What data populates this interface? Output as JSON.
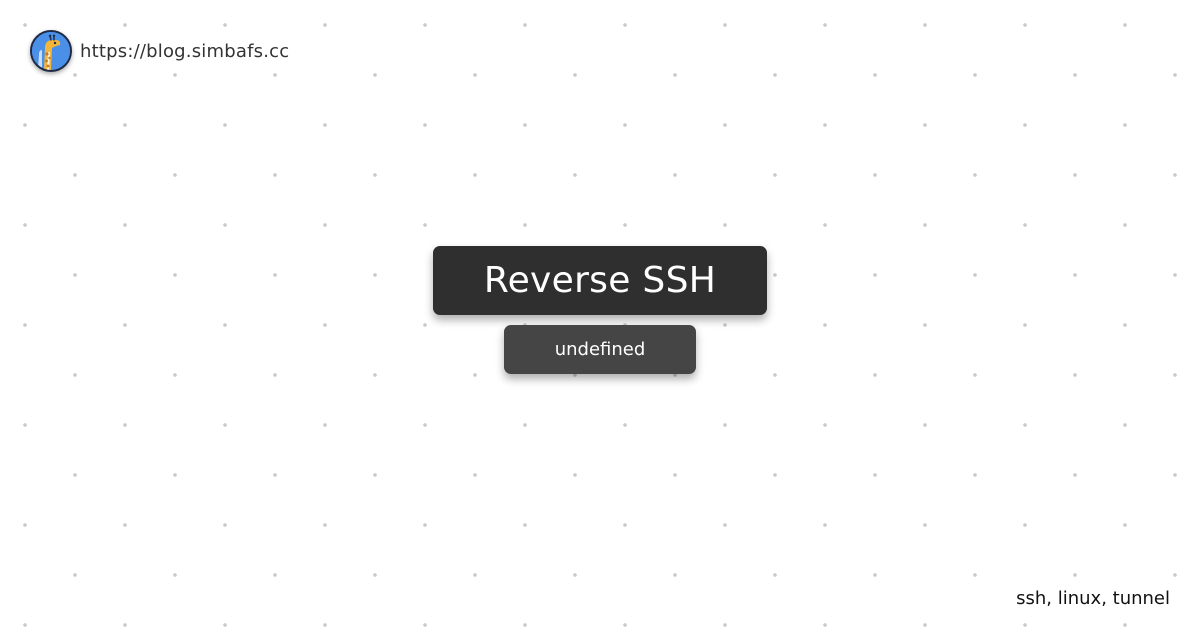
{
  "site": {
    "url": "https://blog.simbafs.cc",
    "avatar_icon": "giraffe-avatar-icon"
  },
  "post": {
    "title": "Reverse SSH",
    "subtitle": "undefined",
    "tags": "ssh, linux, tunnel"
  },
  "colors": {
    "background": "#ffffff",
    "dots": "#c9c9c9",
    "title_box": "#2f2f2f",
    "subtitle_box": "#454545",
    "avatar_bg": "#4a8fe8"
  }
}
